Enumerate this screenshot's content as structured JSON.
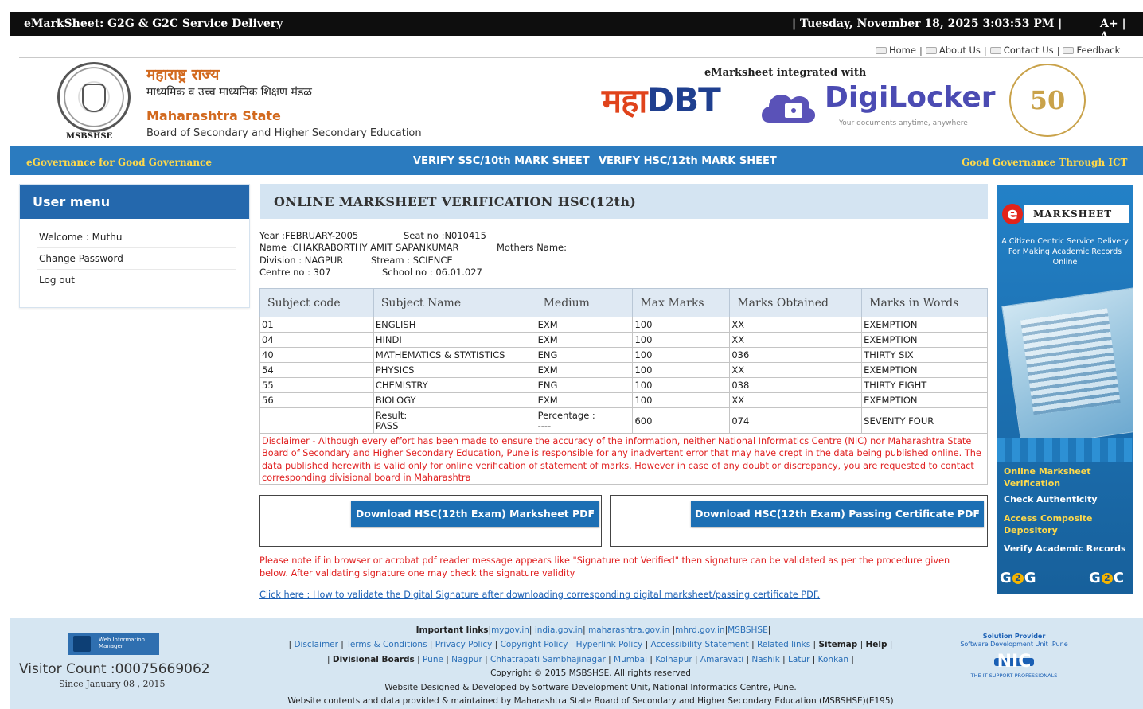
{
  "topbar": {
    "title": "eMarkSheet: G2G & G2C Service Delivery",
    "datetime": "| Tuesday, November 18, 2025 3:03:53 PM |",
    "font_increase": "A+",
    "font_sep": " | ",
    "font_decrease": "A-"
  },
  "toplinks": {
    "home": "Home",
    "about": "About Us",
    "contact": "Contact Us",
    "feedback": "Feedback",
    "sep": "|"
  },
  "header": {
    "seal_caption": "MSBSHSE",
    "marathi_state": "महाराष्ट्र राज्य",
    "marathi_board": "माध्यमिक व उच्च माध्यमिक शिक्षण मंडळ",
    "english_state": "Maharashtra State",
    "english_board": "Board of Secondary and Higher Secondary Education",
    "integrated_with": "eMarksheet integrated with",
    "mahadbt_maha": "महा",
    "mahadbt_dbt": "DBT",
    "digilocker_name": "DigiLocker",
    "digilocker_tagline": "Your documents anytime, anywhere",
    "fifty_years": "50"
  },
  "navbar": {
    "left": "eGovernance for Good Governance",
    "verify_ssc": "VERIFY SSC/10th MARK SHEET",
    "verify_hsc": "VERIFY HSC/12th MARK SHEET",
    "right": "Good Governance Through ICT"
  },
  "user_menu": {
    "heading": "User menu",
    "items": [
      "Welcome : Muthu",
      "Change Password",
      "Log out"
    ]
  },
  "main": {
    "heading": "ONLINE MARKSHEET VERIFICATION HSC(12th)",
    "year": "Year :FEBRUARY-2005",
    "seat": "Seat no :N010415",
    "name": "Name :CHAKRABORTHY AMIT SAPANKUMAR",
    "mothers": "Mothers Name:",
    "division": "Division : NAGPUR",
    "stream": "Stream : SCIENCE",
    "centre": "Centre no : 307",
    "school": "School no : 06.01.027"
  },
  "table": {
    "headers": [
      "Subject code",
      "Subject Name",
      "Medium",
      "Max Marks",
      "Marks Obtained",
      "Marks in Words"
    ],
    "rows": [
      [
        "01",
        "ENGLISH",
        "EXM",
        "100",
        "XX",
        "EXEMPTION"
      ],
      [
        "04",
        "HINDI",
        "EXM",
        "100",
        "XX",
        "EXEMPTION"
      ],
      [
        "40",
        "MATHEMATICS & STATISTICS",
        "ENG",
        "100",
        "036",
        "THIRTY SIX"
      ],
      [
        "54",
        "PHYSICS",
        "EXM",
        "100",
        "XX",
        "EXEMPTION"
      ],
      [
        "55",
        "CHEMISTRY",
        "ENG",
        "100",
        "038",
        "THIRTY EIGHT"
      ],
      [
        "56",
        "BIOLOGY",
        "EXM",
        "100",
        "XX",
        "EXEMPTION"
      ]
    ],
    "total": {
      "result_label": "Result:",
      "result_value": "PASS",
      "percentage_label": "Percentage :",
      "percentage_value": "----",
      "max_total": "600",
      "obtained_total": "074",
      "words_total": "SEVENTY FOUR"
    }
  },
  "disclaimer": "Disclaimer - Although every effort has been made to ensure the accuracy of the information, neither National Informatics Centre (NIC) nor Maharashtra State Board of Secondary and Higher Secondary Education, Pune is responsible for any inadvertent error that may have crept in the data being published online. The data published herewith is valid only for online verification of statement of marks. However in case of any doubt or discrepancy, you are requested to contact corresponding divisional board in Maharashtra",
  "downloads": {
    "marksheet": "Download HSC(12th Exam) Marksheet PDF",
    "certificate": "Download HSC(12th Exam) Passing Certificate PDF"
  },
  "note": "Please note if in browser or acrobat pdf reader message appears like \"Signature not Verified\" then signature can be validated as per the procedure given below. After validating signature one may check the signature validity",
  "click_here": "Click here : How to validate the Digital Signature after downloading corresponding digital marksheet/passing certificate PDF.",
  "banner": {
    "e": "e",
    "marksheet": "MARKSHEET",
    "tagline": "A Citizen Centric Service Delivery For Making Academic Records Online",
    "item1": "Online Marksheet Verification",
    "item2": "Check Authenticity",
    "item3": "Access Composite Depository",
    "item4": "Verify Academic Records",
    "g2g_left": "G",
    "g2g_mid": "2",
    "g2g_right": "G",
    "g2c_left": "G",
    "g2c_mid": "2",
    "g2c_right": "C"
  },
  "footer": {
    "wim": "Web Information Manager",
    "visitor_count": "Visitor Count :00075669062",
    "since": "Since January 08 , 2015",
    "important_links_label": "Important links",
    "important_links": [
      "mygov.in",
      "india.gov.in",
      "maharashtra.gov.in",
      "mhrd.gov.in",
      "MSBSHSE"
    ],
    "policy_links": [
      "Disclaimer",
      "Terms & Conditions",
      "Privacy Policy",
      "Copyright Policy",
      "Hyperlink Policy",
      "Accessibility Statement",
      "Related links"
    ],
    "sitemap": "Sitemap",
    "help": "Help",
    "divisional_label": "Divisional Boards",
    "divisional_boards": [
      "Pune",
      "Nagpur",
      "Chhatrapati Sambhajinagar",
      "Mumbai",
      "Kolhapur",
      "Amaravati",
      "Nashik",
      "Latur",
      "Konkan"
    ],
    "copyright": "Copyright © 2015 MSBSHSE. All rights reserved",
    "designed_by": "Website Designed & Developed by Software Development Unit, National Informatics Centre, Pune.",
    "contents_by": "Website contents and data provided & maintained by Maharashtra State Board of Secondary and Higher Secondary Education (MSBSHSE)(E195)",
    "nic_provider": "Solution Provider",
    "nic_unit": "Software Development Unit ,Pune",
    "nic_name": "NIC",
    "nic_tagline": "THE IT SUPPORT PROFESSIONALS"
  }
}
